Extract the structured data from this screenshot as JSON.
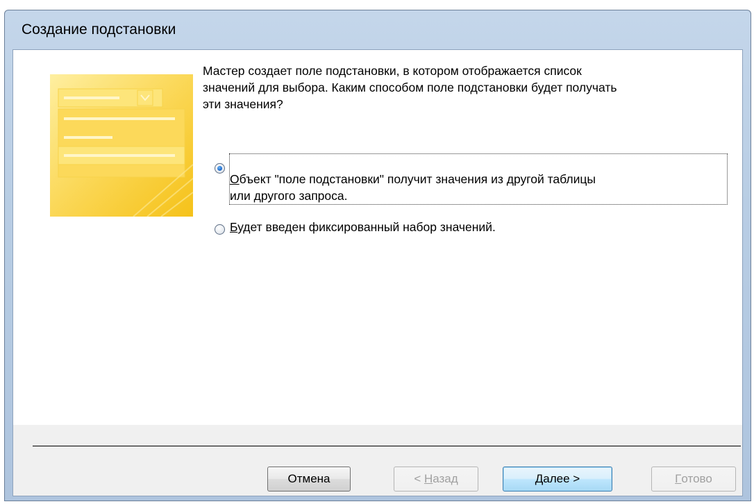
{
  "top_heading_fragment": "",
  "window": {
    "title": "Создание подстановки"
  },
  "wizard": {
    "description": "Мастер создает поле подстановки, в котором отображается список\nзначений для выбора.  Каким способом поле подстановки будет получать\n эти значения?",
    "options": [
      {
        "label_first": "О",
        "label_rest": "бъект \"поле подстановки\" получит значения из другой таблицы\nили другого запроса.",
        "checked": true
      },
      {
        "label_first": "Б",
        "label_rest": "удет введен фиксированный набор значений.",
        "checked": false
      }
    ]
  },
  "buttons": {
    "cancel": {
      "label": "Отмена",
      "enabled": true
    },
    "back": {
      "prefix": "< ",
      "accel": "Н",
      "rest": "азад",
      "enabled": false
    },
    "next": {
      "accel": "Д",
      "rest": "алее >",
      "enabled": true
    },
    "finish": {
      "accel": "Г",
      "rest": "отово",
      "enabled": false
    }
  },
  "colors": {
    "illustration": "#fbd650",
    "default_button_border": "#3c7fb1",
    "radio_dot": "#1f6fd1"
  }
}
